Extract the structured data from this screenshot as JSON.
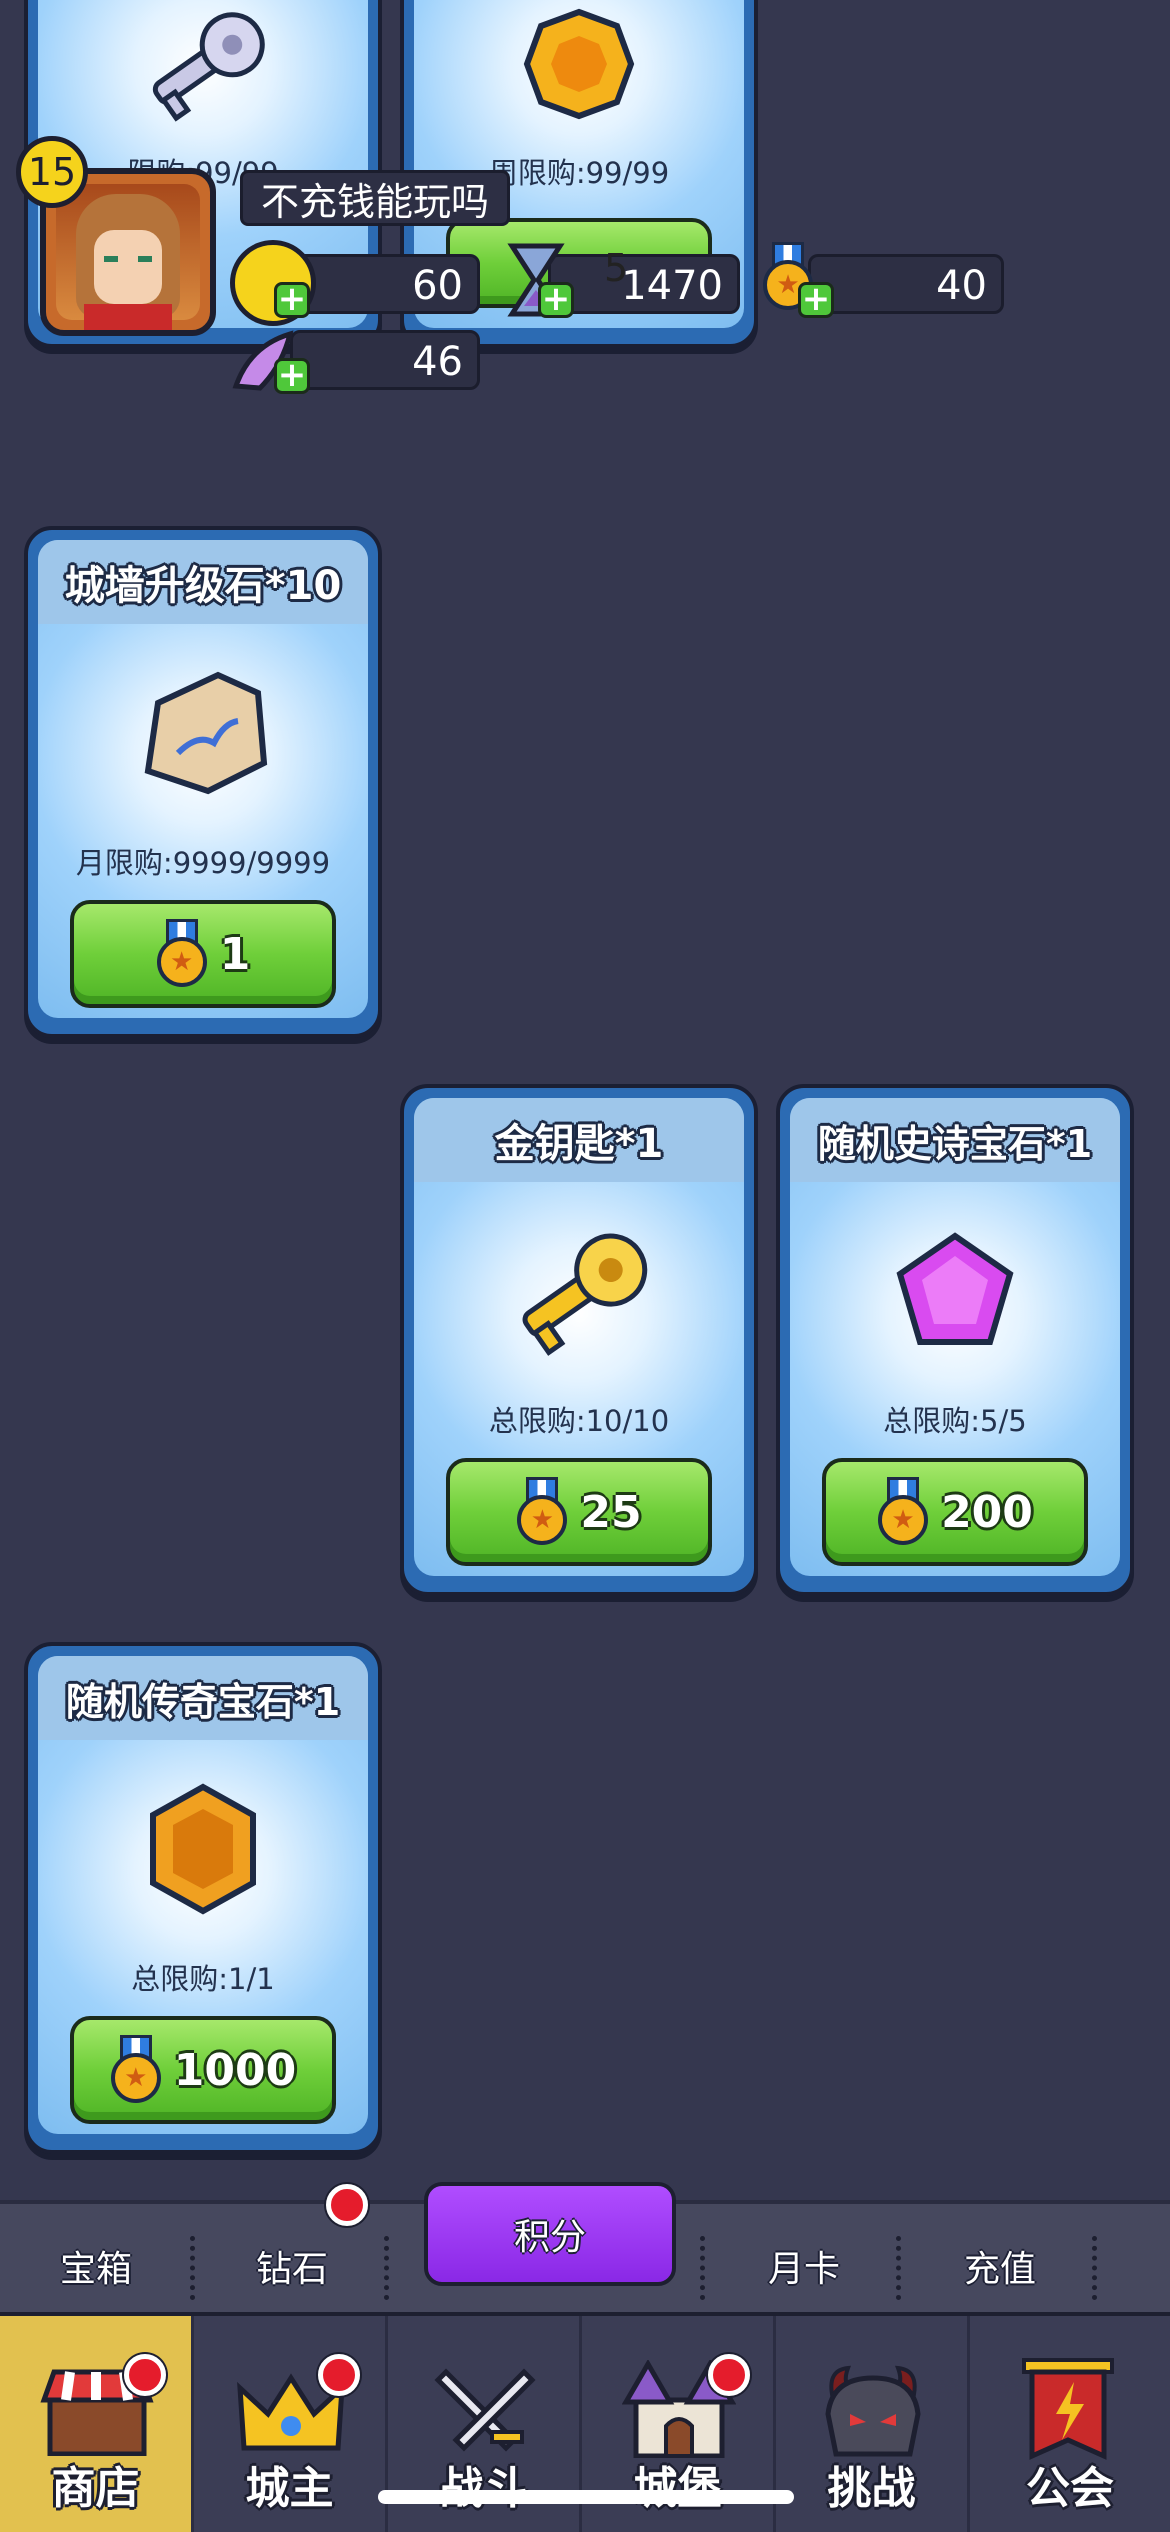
{
  "hud": {
    "player_level": "15",
    "player_name": "不充钱能玩吗",
    "gold_value": "60",
    "hourglass_badge": "5",
    "hourglass_value": "1470",
    "medal_value": "40",
    "potion_value": "46",
    "partial_limit_left": "限购:99/99",
    "partial_limit_right": "周限购:99/99"
  },
  "items": [
    {
      "title": "城墙升级石*10",
      "limit": "月限购:9999/9999",
      "cost": "1",
      "icon": "rune-stone-icon"
    },
    {
      "title": "金钥匙*1",
      "limit": "总限购:10/10",
      "cost": "25",
      "icon": "gold-key-icon"
    },
    {
      "title": "随机史诗宝石*1",
      "limit": "总限购:5/5",
      "cost": "200",
      "icon": "purple-gem-icon"
    },
    {
      "title": "随机传奇宝石*1",
      "limit": "总限购:1/1",
      "cost": "1000",
      "icon": "orange-gem-icon"
    }
  ],
  "tabs": {
    "chest": "宝箱",
    "diamond": "钻石",
    "points": "积分",
    "monthly": "月卡",
    "recharge": "充值"
  },
  "nav": {
    "shop": "商店",
    "lord": "城主",
    "battle": "战斗",
    "castle": "城堡",
    "challenge": "挑战",
    "guild": "公会"
  },
  "colors": {
    "background": "#35374f",
    "card_blue": "#2c6bb3",
    "buy_green": "#6fcf3a",
    "active_tab_purple": "#9a35f2",
    "nav_active": "#e2c14f",
    "notification_red": "#e51c2c"
  }
}
